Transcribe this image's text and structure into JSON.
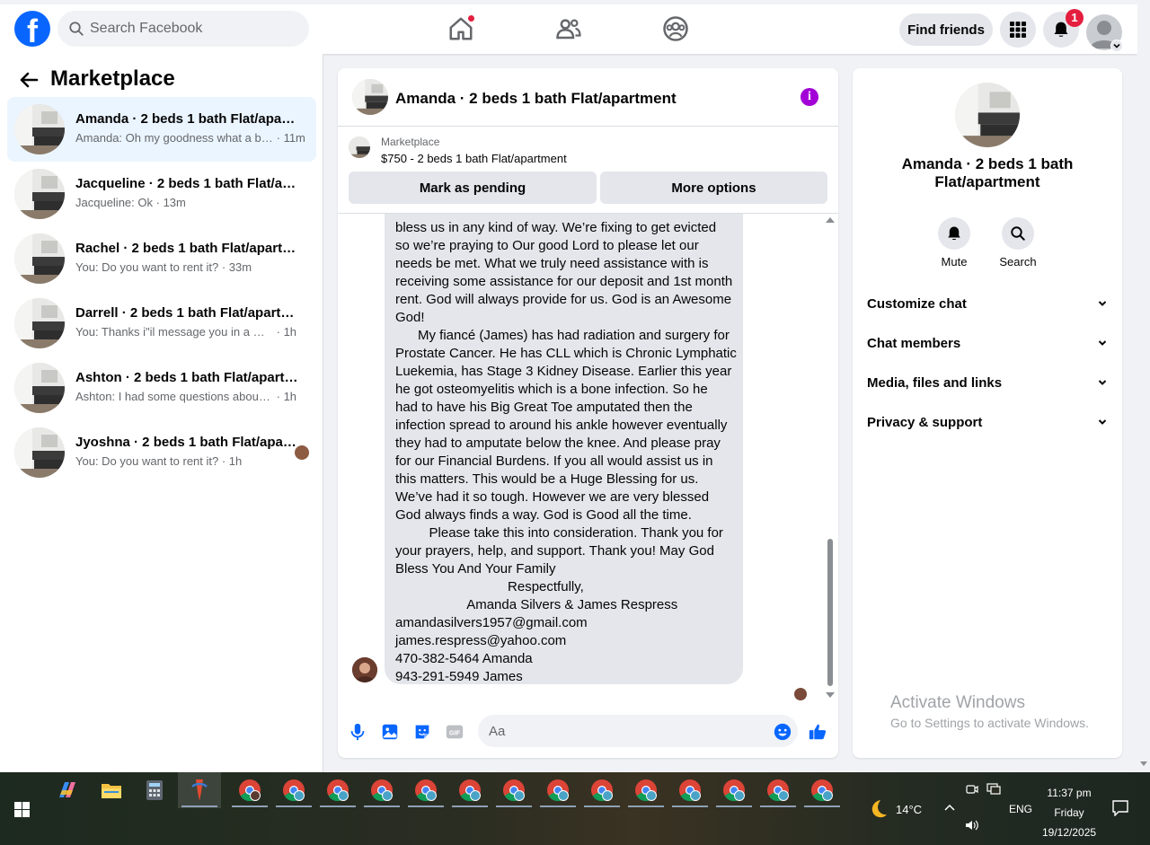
{
  "topbar": {
    "logo": "f",
    "search_placeholder": "Search Facebook",
    "find_friends": "Find friends",
    "notifications_count": "1",
    "icons": [
      "facebook-logo",
      "search-icon",
      "home-icon",
      "friends-icon",
      "groups-icon",
      "menu-grid-icon",
      "bell-icon",
      "avatar"
    ]
  },
  "sidebar": {
    "title": "Marketplace",
    "conversations": [
      {
        "title": "Amanda · 2 beds 1 bath Flat/apartment",
        "preview": "Amanda: Oh my goodness what a bl...",
        "time": "11m",
        "active": true
      },
      {
        "title": "Jacqueline · 2 beds 1 bath Flat/apartment",
        "preview": "Jacqueline: Ok",
        "time": "13m"
      },
      {
        "title": "Rachel · 2 beds 1 bath Flat/apartment",
        "preview": "You: Do you want to rent it?",
        "time": "33m"
      },
      {
        "title": "Darrell · 2 beds 1 bath Flat/apartment",
        "preview": "You: Thanks i\"il message you in a mo...",
        "time": "1h"
      },
      {
        "title": "Ashton · 2 beds 1 bath Flat/apartment",
        "preview": "Ashton: I had some questions about t...",
        "time": "1h"
      },
      {
        "title": "Jyoshna · 2 beds 1 bath Flat/apartment",
        "preview": "You: Do you want to rent it?",
        "time": "1h"
      }
    ]
  },
  "chat": {
    "title": "Amanda · 2 beds 1 bath Flat/apartment",
    "marketplace_label": "Marketplace",
    "listing": "$750 - 2 beds 1 bath Flat/apartment",
    "mark_pending": "Mark as pending",
    "more_options": "More options",
    "message": "bless us in any kind of way. We’re fixing to get evicted\nso we’re praying to Our good Lord to please let our\nneeds be met. What we truly need assistance with is\nreceiving some assistance for our deposit and 1st month\nrent. God will always provide for us. God is an Awesome\nGod!\n      My fiancé (James) has had radiation and surgery for\nProstate Cancer. He has CLL which is Chronic Lymphatic\nLuekemia, has Stage 3 Kidney Disease. Earlier this year\nhe got osteomyelitis which is a bone infection. So he\nhad to have his Big Great Toe amputated then the\ninfection spread to around his ankle however eventually\nthey had to amputate below the knee. And please pray\nfor our Financial Burdens. If you all would assist us in\nthis matters. This would be a Huge Blessing for us.\nWe’ve had it so tough. However we are very blessed\nGod always finds a way. God is Good all the time.\n         Please take this into consideration. Thank you for\nyour prayers, help, and support. Thank you! May God\nBless You And Your Family\n                              Respectfully,\n                   Amanda Silvers & James Respress\namandasilvers1957@gmail.com\njames.respress@yahoo.com\n470-382-5464 Amanda\n943-291-5949 James",
    "input_placeholder": "Aa"
  },
  "right_panel": {
    "title": "Amanda · 2 beds 1 bath Flat/apartment",
    "mute": "Mute",
    "search": "Search",
    "sections": [
      "Customize chat",
      "Chat members",
      "Media, files and links",
      "Privacy & support"
    ]
  },
  "watermark": {
    "line1": "Activate Windows",
    "line2": "Go to Settings to activate Windows."
  },
  "taskbar": {
    "temperature": "14°C",
    "language": "ENG",
    "time": "11:37 pm",
    "day": "Friday",
    "date": "19/12/2025"
  },
  "colors": {
    "brand": "#0866ff",
    "accent_purple": "#a200d6",
    "notification_red": "#e41e3f",
    "active_row": "#ebf5ff"
  }
}
